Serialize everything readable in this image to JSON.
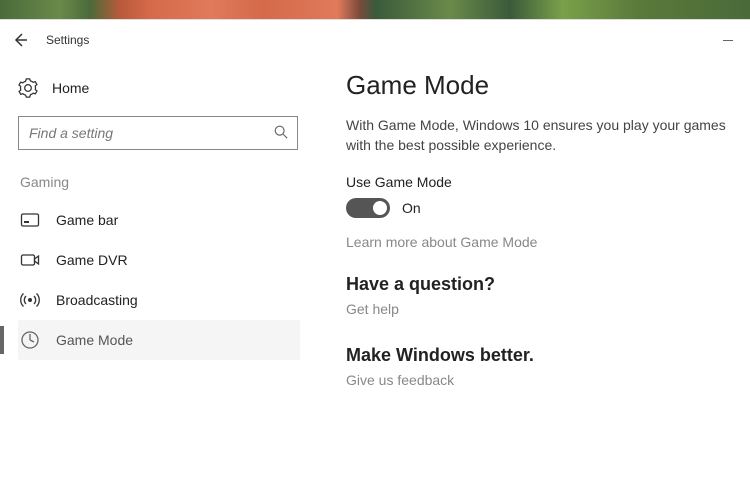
{
  "titlebar": {
    "title": "Settings"
  },
  "sidebar": {
    "home_label": "Home",
    "search_placeholder": "Find a setting",
    "category_label": "Gaming",
    "items": [
      {
        "label": "Game bar"
      },
      {
        "label": "Game DVR"
      },
      {
        "label": "Broadcasting"
      },
      {
        "label": "Game Mode"
      }
    ]
  },
  "main": {
    "title": "Game Mode",
    "description": "With Game Mode, Windows 10 ensures you play your games with the best possible experience.",
    "toggle_label": "Use Game Mode",
    "toggle_state": "On",
    "learn_more": "Learn more about Game Mode",
    "question_heading": "Have a question?",
    "get_help": "Get help",
    "better_heading": "Make Windows better.",
    "feedback": "Give us feedback"
  }
}
